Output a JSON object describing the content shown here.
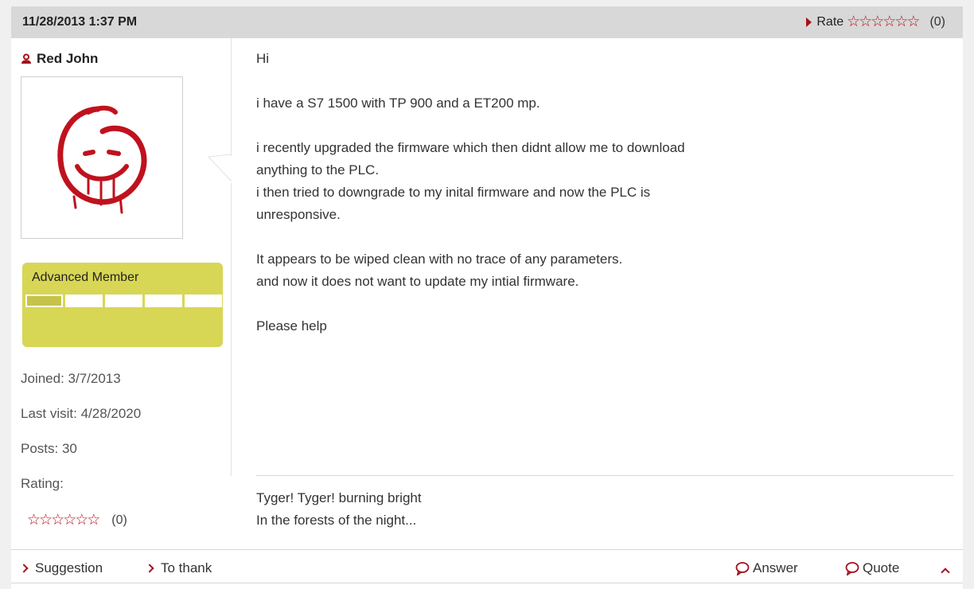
{
  "post": {
    "date": "11/28/2013 1:37 PM",
    "rate_label": "Rate",
    "rate_count": "(0)"
  },
  "user": {
    "name": "Red John",
    "rank": "Advanced Member",
    "rank_level": 1,
    "rank_max": 5,
    "joined": "Joined: 3/7/2013",
    "last_visit": "Last visit: 4/28/2020",
    "posts": "Posts: 30",
    "rating_label": "Rating:",
    "rating_count": "(0)"
  },
  "message": {
    "lines": [
      "Hi",
      "",
      "i have a S7 1500 with TP 900 and a ET200 mp.",
      "",
      "i recently upgraded the firmware which then didnt allow me to download",
      "anything to the PLC.",
      "i then tried to downgrade to my inital firmware and now the PLC is",
      "unresponsive.",
      "",
      "It appears to be wiped clean with no trace of any parameters.",
      "and now it does not want to update my intial firmware.",
      "",
      "Please help"
    ]
  },
  "signature": {
    "line1": "Tyger! Tyger! burning bright",
    "line2": "In the forests of the night..."
  },
  "footer": {
    "suggestion": "Suggestion",
    "thank": "To thank",
    "answer": "Answer",
    "quote": "Quote"
  },
  "colors": {
    "accent_red": "#a5101c",
    "rank_yellow": "#d8d655",
    "header_gray": "#d8d8d8"
  },
  "icons": {
    "user": "user-icon",
    "star": "star-outline-icon",
    "rate_arrow": "triangle-right-icon",
    "footer_link": "chevron-right-icon",
    "speech": "speech-bubble-icon",
    "scroll_top": "chevron-up-icon"
  }
}
